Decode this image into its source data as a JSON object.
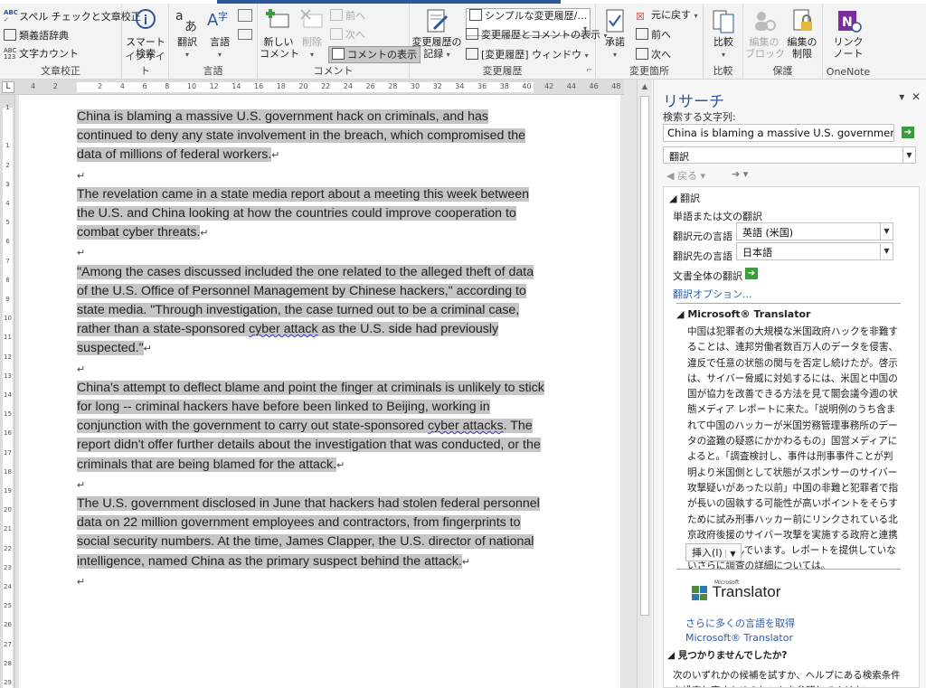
{
  "ribbon": {
    "proofing": {
      "spelling": "スペル チェックと文章校正",
      "thesaurus": "類義語辞典",
      "wordcount": "文字カウント",
      "label": "文章校正"
    },
    "insights": {
      "smart_lookup": "スマート\n検索",
      "label": "インサイト"
    },
    "language": {
      "translate": "翻訳",
      "language": "言語",
      "label": "言語"
    },
    "comments": {
      "new": "新しい\nコメント",
      "delete": "削除",
      "prev": "前へ",
      "next": "次へ",
      "show": "コメントの表示",
      "label": "コメント"
    },
    "tracking": {
      "track": "変更履歴の\n記録",
      "markup": "シンプルな変更履歴/…",
      "show_markup": "変更履歴とコメントの表示",
      "pane": "[変更履歴] ウィンドウ",
      "label": "変更履歴"
    },
    "changes": {
      "accept": "承諾",
      "reject": "元に戻す",
      "prev": "前へ",
      "next": "次へ",
      "label": "変更箇所"
    },
    "compare": {
      "compare": "比較",
      "label": "比較"
    },
    "protect": {
      "block": "編集の\nブロック",
      "restrict": "編集の\n制限",
      "label": "保護"
    },
    "onenote": {
      "linked": "リンク\nノート",
      "label": "OneNote"
    }
  },
  "ruler": {
    "corner": "L",
    "ticks": [
      "4",
      "2",
      "",
      "2",
      "4",
      "6",
      "8",
      "10",
      "12",
      "14",
      "16",
      "18",
      "20",
      "22",
      "24",
      "26",
      "28",
      "30",
      "32",
      "34",
      "36",
      "38",
      "40",
      "42",
      "44",
      "46",
      "48"
    ]
  },
  "vruler": {
    "ticks": [
      "1",
      "",
      "1",
      "2",
      "3",
      "4",
      "5",
      "6",
      "7",
      "8",
      "9",
      "10",
      "11",
      "12",
      "13",
      "14",
      "15",
      "16",
      "17",
      "18",
      "19",
      "20",
      "21",
      "22",
      "23",
      "24",
      "25",
      "26",
      "27",
      "28",
      "29",
      "30"
    ]
  },
  "document": {
    "p1": "China is blaming a massive U.S. government hack on criminals, and has continued to deny any state involvement in the breach, which compromised the data of millions of federal workers.",
    "p2": "The revelation came in a state media report about a meeting this week between the U.S. and China looking at how the countries could improve cooperation to combat cyber threats.",
    "p3a": "\"Among the cases discussed included the one related to the alleged theft of data of the U.S. Office of Personnel Management by Chinese hackers,\" according to state media. \"Through investigation, the case turned out to be a criminal case, rather than a state-sponsored ",
    "p3sq": "cyber attack",
    "p3b": " as the U.S. side had previously suspected.\"",
    "p4a": "China's attempt to deflect blame and point the finger at criminals is unlikely to stick for long -- criminal hackers have before been linked to Beijing, working in conjunction with the government to carry out state-sponsored ",
    "p4sq": "cyber attacks",
    "p4b": ". The report didn't offer further details about the investigation that was conducted, or the criminals that are being blamed for the attack.",
    "p5": "The U.S. government disclosed in June that hackers had stolen federal personnel data on 22 million government employees and contractors, from fingerprints to social security numbers. At the time, James Clapper, the U.S. director of national intelligence, named China as the primary suspect behind the attack.",
    "pilcrow": "↵"
  },
  "pane": {
    "title": "リサーチ",
    "search_label": "検索する文字列:",
    "search_value": "China is blaming a massive U.S. government ha",
    "service": "翻訳",
    "back": "戻る",
    "section": "翻訳",
    "word_translate": "単語または文の翻訳",
    "from_label": "翻訳元の言語",
    "from_value": "英語 (米国)",
    "to_label": "翻訳先の言語",
    "to_value": "日本語",
    "doc_translate": "文書全体の翻訳",
    "options": "翻訳オプション...",
    "ms_translator": "Microsoft® Translator",
    "translation": "中国は犯罪者の大規模な米国政府ハックを非難することは、連邦労働者数百万人のデータを侵害、違反で任意の状態の関与を否定し続けたが。啓示は、サイバー脅威に対処するには、米国と中国の国が協力を改善できる方法を見て閣会議今週の状態メディア レポートに来た。「説明例のうち含まれて中国のハッカーが米国労務管理事務所のデータの盗難の疑惑にかかわるもの」国営メディアによると。「調査検討し、事件は刑事事件ことが判明より米国側として状態がスポンサーのサイバー攻撃疑いがあった以前」中国の非難と犯罪者で指が長いの固執する可能性が高いポイントをそらすために試み刑事ハッカー前にリンクされている北京政府後援のサイバー攻撃を実施する政府と連携して取り組んでいます。レポートを提供していないさらに調査の詳細については。",
    "insert": "挿入(I)",
    "logo_small": "Microsoft",
    "logo": "Translator",
    "more_langs": "さらに多くの言語を取得",
    "ms_link": "Microsoft® Translator",
    "not_found": "見つかりませんでしたか?",
    "hint": "次のいずれかの候補を試すか、ヘルプにある検索条件を設定し直すためのヒントを参照してください。"
  },
  "colors": {
    "accent": "#2b579a",
    "highlight": "#c5c5c5",
    "go": "#3a9c3a"
  }
}
